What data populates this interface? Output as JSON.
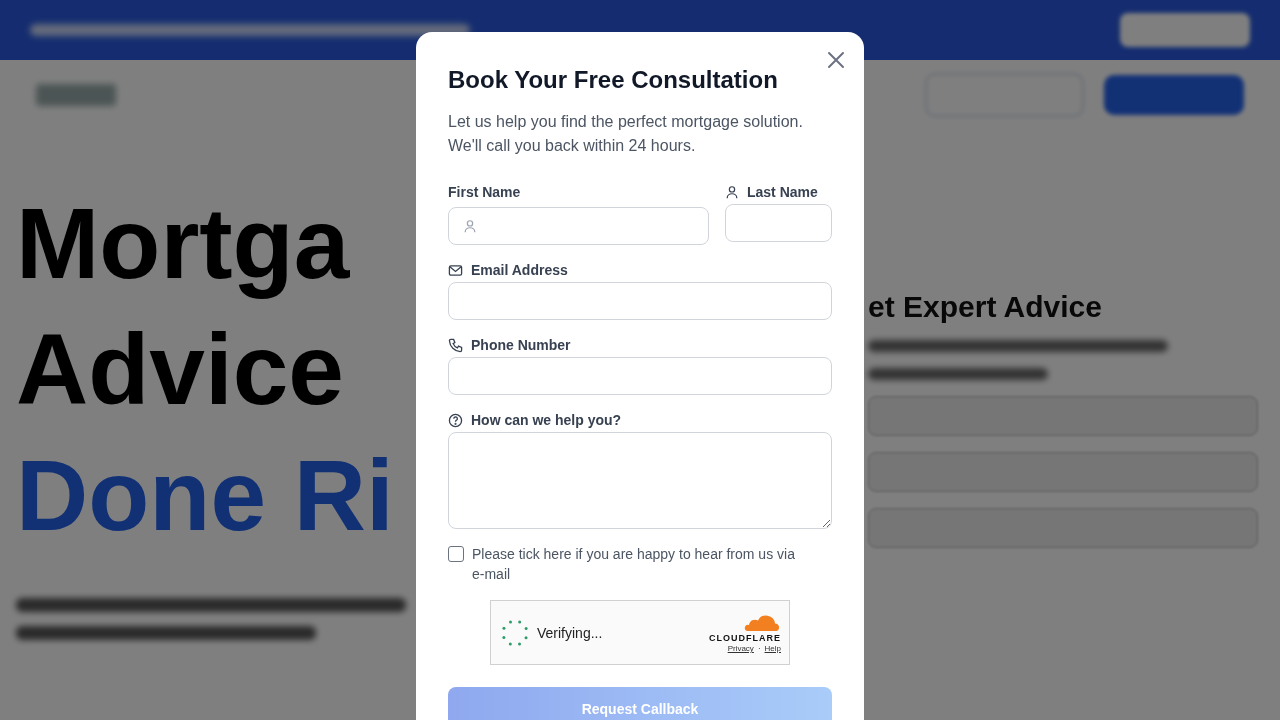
{
  "background": {
    "headline": [
      "Mortga",
      "Advice"
    ],
    "accent": "Done Ri",
    "side_title": "et Expert Advice"
  },
  "modal": {
    "title": "Book Your Free Consultation",
    "subtitle": "Let us help you find the perfect mortgage solution. We'll call you back within 24 hours.",
    "name_fields": [
      {
        "label": "First Name",
        "kind": "name",
        "icon_in_field": true
      },
      {
        "label": "Last Name",
        "kind": "name",
        "icon_in_field": false
      }
    ],
    "fields": [
      {
        "label": "Email Address",
        "kind": "email",
        "icon_in_field": false
      },
      {
        "label": "Phone Number",
        "kind": "phone",
        "icon_in_field": false
      },
      {
        "label": "How can we help you?",
        "kind": "message",
        "icon_in_field": false
      }
    ],
    "consent": {
      "label": "Please tick here if you are happy to hear from us via e-mail",
      "checked": false
    },
    "captcha": {
      "status": "Verifying...",
      "brand": "CLOUDFLARE",
      "links": [
        "Privacy",
        "Help"
      ],
      "separator": "·"
    },
    "submit": {
      "label": "Request Callback",
      "disabled": true
    }
  }
}
